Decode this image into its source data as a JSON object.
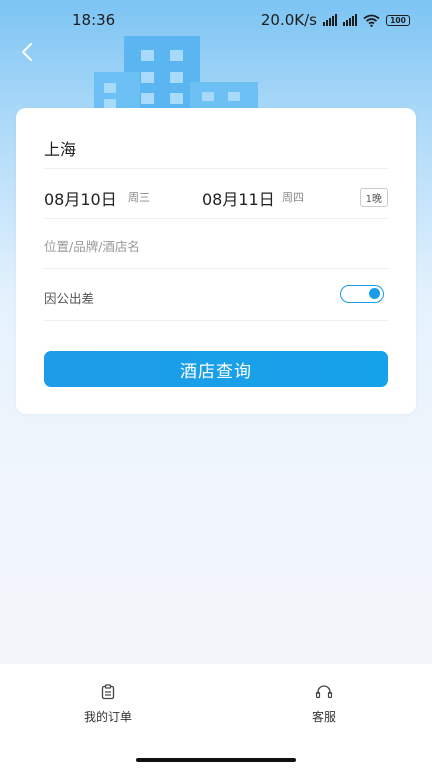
{
  "status_bar": {
    "time": "18:36",
    "speed": "20.0K/s",
    "battery": "100"
  },
  "form": {
    "city": "上海",
    "checkin_date": "08月10日",
    "checkin_weekday": "周三",
    "checkout_date": "08月11日",
    "checkout_weekday": "周四",
    "nights": "1晚",
    "search_placeholder": "位置/品牌/酒店名",
    "business_trip_label": "因公出差",
    "business_trip_on": true,
    "query_button": "酒店查询"
  },
  "bottom_nav": {
    "orders_label": "我的订单",
    "service_label": "客服"
  },
  "colors": {
    "accent": "#1a9be8",
    "header_sky": "#7cc4f3",
    "building": "#5ab5f0"
  }
}
